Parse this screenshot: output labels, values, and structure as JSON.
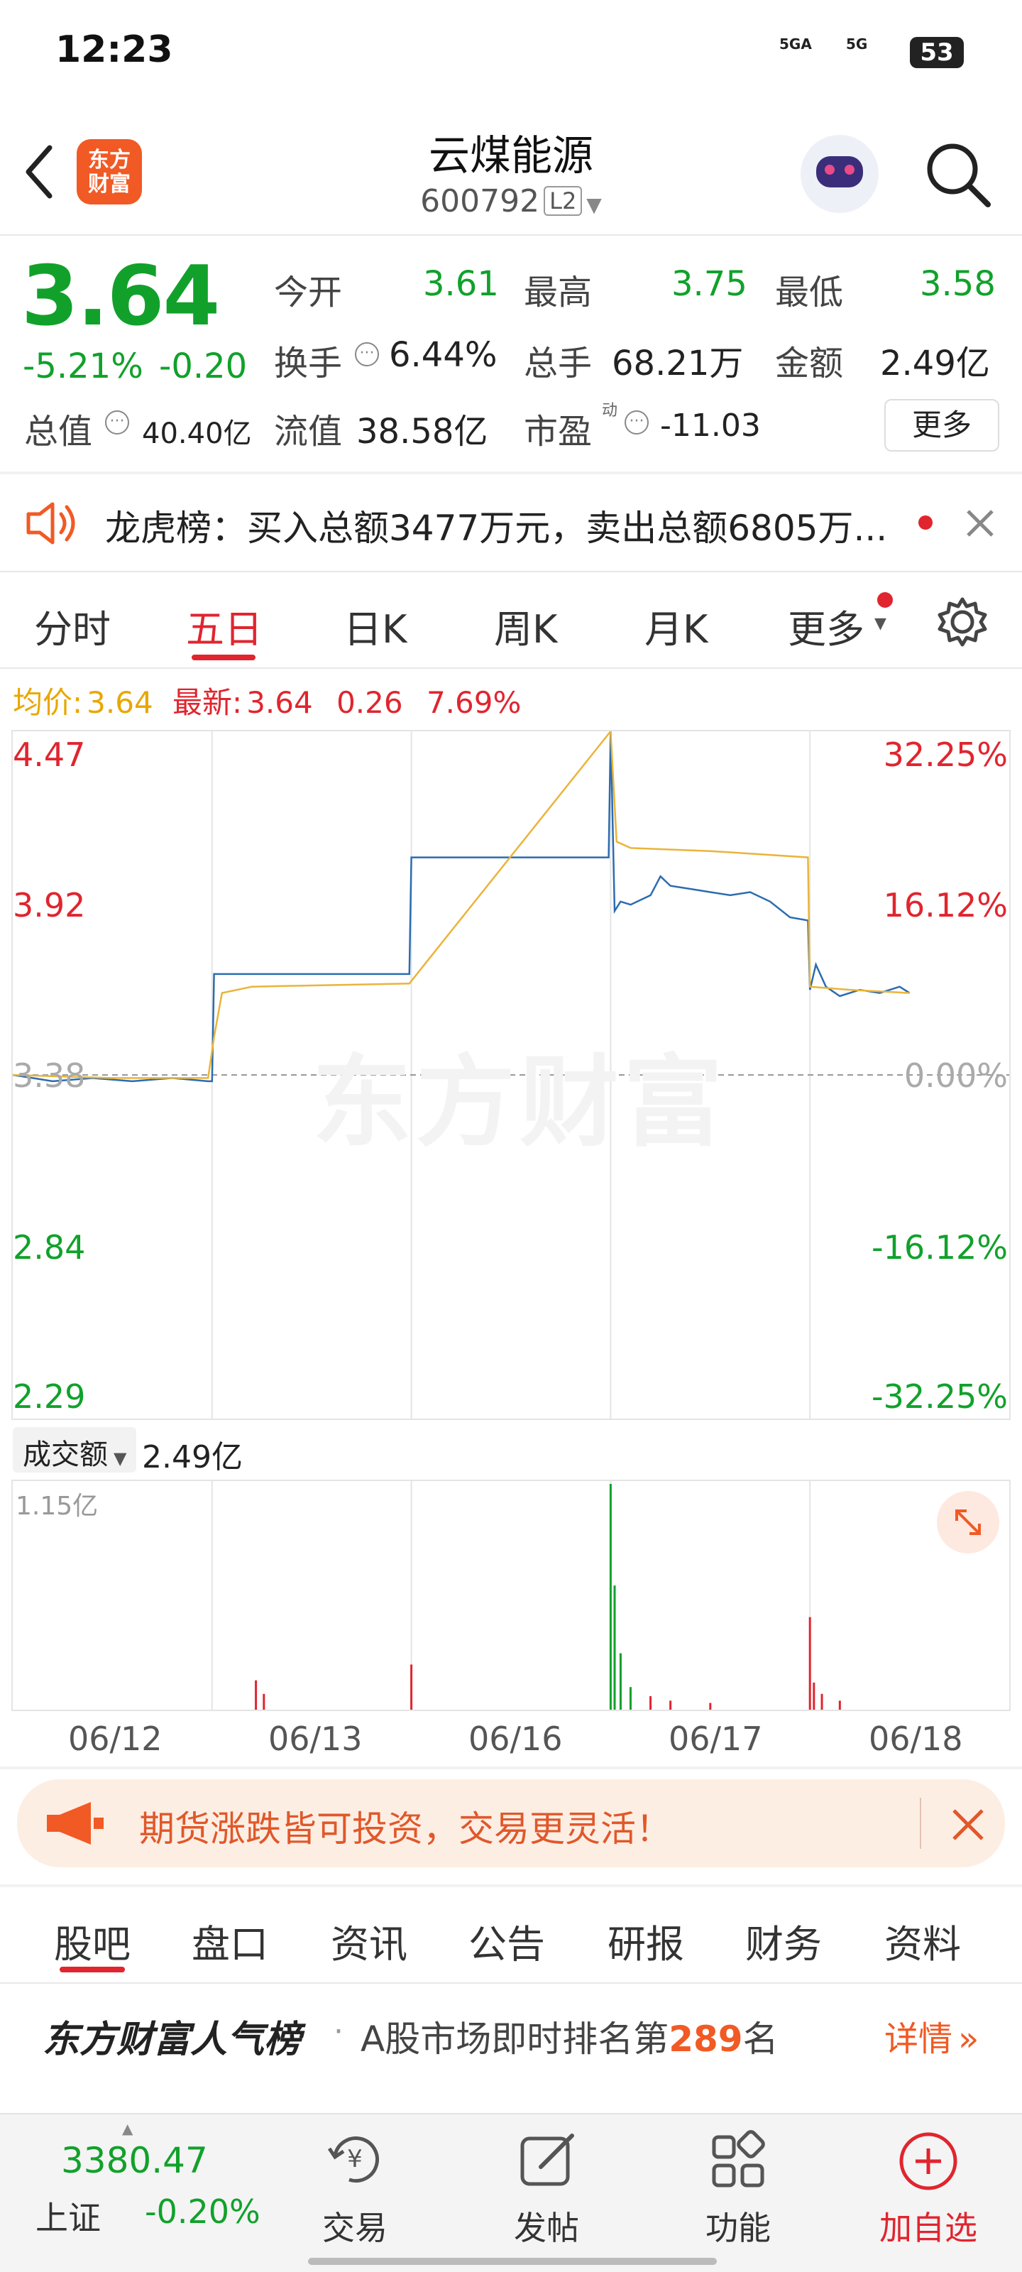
{
  "status": {
    "time": "12:23",
    "battery": "53",
    "net1": "5GA",
    "net2": "5G"
  },
  "header": {
    "logo": "东方财富",
    "title": "云煤能源",
    "code": "600792",
    "level": "L2"
  },
  "quote": {
    "price": "3.64",
    "change_pct": "-5.21%",
    "change": "-0.20",
    "open_label": "今开",
    "open": "3.61",
    "high_label": "最高",
    "high": "3.75",
    "low_label": "最低",
    "low": "3.58",
    "turnover_label": "换手",
    "turnover": "6.44%",
    "volume_label": "总手",
    "volume": "68.21万",
    "amount_label": "金额",
    "amount": "2.49亿",
    "mktcap_label": "总值",
    "mktcap": "40.40亿",
    "float_label": "流值",
    "float": "38.58亿",
    "pe_label": "市盈",
    "pe_sup": "动",
    "pe": "-11.03",
    "more": "更多"
  },
  "notice": {
    "text": "龙虎榜：买入总额3477万元，卖出总额6805万..."
  },
  "tabs": [
    "分时",
    "五日",
    "日K",
    "周K",
    "月K",
    "更多"
  ],
  "active_tab": "五日",
  "legend": {
    "avg_label": "均价:",
    "avg": "3.64",
    "latest_label": "最新:",
    "latest": "3.64",
    "diff": "0.26",
    "diff_pct": "7.69%"
  },
  "chart_data": {
    "type": "line",
    "x": [
      "06/12",
      "06/13",
      "06/16",
      "06/17",
      "06/18"
    ],
    "y_left_ticks": [
      "4.47",
      "3.92",
      "3.38",
      "2.84",
      "2.29"
    ],
    "y_right_ticks": [
      "32.25%",
      "16.12%",
      "0.00%",
      "-16.12%",
      "-32.25%"
    ],
    "ylim": [
      2.29,
      4.47
    ],
    "prev_close": 3.38,
    "series": [
      {
        "name": "最新",
        "values": [
          [
            0.0,
            3.38
          ],
          [
            0.1,
            3.37
          ],
          [
            0.2,
            3.36
          ],
          [
            0.4,
            3.37
          ],
          [
            0.6,
            3.36
          ],
          [
            0.8,
            3.37
          ],
          [
            0.98,
            3.36
          ],
          [
            1.0,
            3.36
          ],
          [
            1.01,
            3.7
          ],
          [
            1.5,
            3.7
          ],
          [
            1.99,
            3.7
          ],
          [
            2.0,
            4.07
          ],
          [
            2.5,
            4.07
          ],
          [
            2.99,
            4.07
          ],
          [
            3.0,
            4.47
          ],
          [
            3.02,
            3.9
          ],
          [
            3.05,
            3.93
          ],
          [
            3.1,
            3.92
          ],
          [
            3.2,
            3.95
          ],
          [
            3.25,
            4.01
          ],
          [
            3.3,
            3.98
          ],
          [
            3.4,
            3.97
          ],
          [
            3.5,
            3.96
          ],
          [
            3.6,
            3.95
          ],
          [
            3.7,
            3.96
          ],
          [
            3.8,
            3.93
          ],
          [
            3.9,
            3.88
          ],
          [
            3.99,
            3.87
          ],
          [
            4.0,
            3.65
          ],
          [
            4.03,
            3.73
          ],
          [
            4.08,
            3.66
          ],
          [
            4.15,
            3.63
          ],
          [
            4.25,
            3.65
          ],
          [
            4.35,
            3.64
          ],
          [
            4.45,
            3.66
          ],
          [
            4.5,
            3.64
          ]
        ]
      },
      {
        "name": "均价",
        "values": [
          [
            0.0,
            3.38
          ],
          [
            0.5,
            3.37
          ],
          [
            0.98,
            3.37
          ],
          [
            1.01,
            3.5
          ],
          [
            1.05,
            3.64
          ],
          [
            1.2,
            3.66
          ],
          [
            1.99,
            3.67
          ],
          [
            3.0,
            4.47
          ],
          [
            3.03,
            4.12
          ],
          [
            3.1,
            4.1
          ],
          [
            3.5,
            4.09
          ],
          [
            3.99,
            4.07
          ],
          [
            4.0,
            3.66
          ],
          [
            4.2,
            3.65
          ],
          [
            4.5,
            3.64
          ]
        ]
      }
    ],
    "volume": {
      "label": "成交额",
      "total": "2.49亿",
      "max_label": "1.15亿",
      "spikes": [
        [
          1.22,
          0.13
        ],
        [
          1.26,
          0.07
        ],
        [
          2.0,
          0.2
        ],
        [
          3.0,
          1.0
        ],
        [
          3.02,
          0.55
        ],
        [
          3.05,
          0.25
        ],
        [
          3.1,
          0.1
        ],
        [
          3.2,
          0.06
        ],
        [
          3.3,
          0.04
        ],
        [
          3.5,
          0.03
        ],
        [
          4.0,
          0.41
        ],
        [
          4.02,
          0.12
        ],
        [
          4.06,
          0.07
        ],
        [
          4.15,
          0.04
        ]
      ]
    }
  },
  "toast": {
    "text": "期货涨跌皆可投资，交易更灵活！"
  },
  "bottom_tabs": [
    "股吧",
    "盘口",
    "资讯",
    "公告",
    "研报",
    "财务",
    "资料"
  ],
  "popularity": {
    "title": "东方财富人气榜",
    "prefix": "A股市场即时排名第",
    "rank": "289",
    "suffix": "名",
    "link": "详情"
  },
  "bottom_bar": {
    "index_value": "3380.47",
    "index_name": "上证",
    "index_change": "-0.20%",
    "items": [
      "交易",
      "发帖",
      "功能",
      "加自选"
    ]
  }
}
